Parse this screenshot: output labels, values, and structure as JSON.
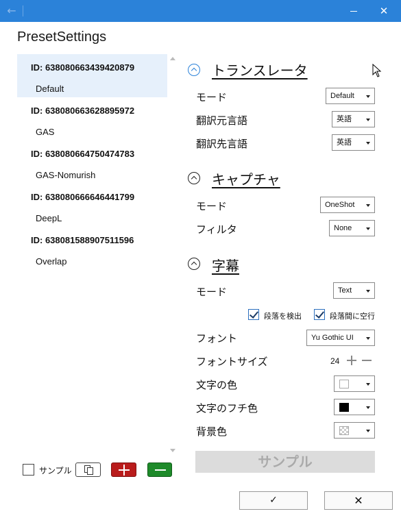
{
  "window": {
    "back_glyph": "←",
    "close_glyph": "✕"
  },
  "page_title": "PresetSettings",
  "presets": [
    {
      "id": "ID: 638080663439420879",
      "name": "Default",
      "selected": true
    },
    {
      "id": "ID: 638080663628895972",
      "name": "GAS",
      "selected": false
    },
    {
      "id": "ID: 638080664750474783",
      "name": "GAS-Nomurish",
      "selected": false
    },
    {
      "id": "ID: 638080666646441799",
      "name": "DeepL",
      "selected": false
    },
    {
      "id": "ID: 638081588907511596",
      "name": "Overlap",
      "selected": false
    }
  ],
  "left_controls": {
    "sample_label": "サンプル",
    "sample_checked": false
  },
  "translator": {
    "title": "トランスレータ",
    "mode_label": "モード",
    "mode_value": "Default",
    "source_label": "翻訳元言語",
    "source_value": "英語",
    "target_label": "翻訳先言語",
    "target_value": "英語"
  },
  "capture": {
    "title": "キャプチャ",
    "mode_label": "モード",
    "mode_value": "OneShot",
    "filter_label": "フィルタ",
    "filter_value": "None"
  },
  "subtitle": {
    "title": "字幕",
    "mode_label": "モード",
    "mode_value": "Text",
    "detect_paragraph_label": "段落を検出",
    "detect_paragraph_checked": true,
    "paragraph_gap_label": "段落間に空行",
    "paragraph_gap_checked": true,
    "font_label": "フォント",
    "font_value": "Yu Gothic UI",
    "font_size_label": "フォントサイズ",
    "font_size_value": "24",
    "text_color_label": "文字の色",
    "text_color": "#ffffff",
    "outline_color_label": "文字のフチ色",
    "outline_color": "#000000",
    "background_label": "背景色",
    "background_color": "transparent"
  },
  "sample_preview_text": "サンプル",
  "footer": {
    "ok_glyph": "✓",
    "cancel_glyph": "✕"
  },
  "colors": {
    "titlebar": "#2b82d9",
    "selected_row": "#e6f0fb",
    "add_button": "#b91c1c",
    "remove_button": "#1e8a2a"
  }
}
